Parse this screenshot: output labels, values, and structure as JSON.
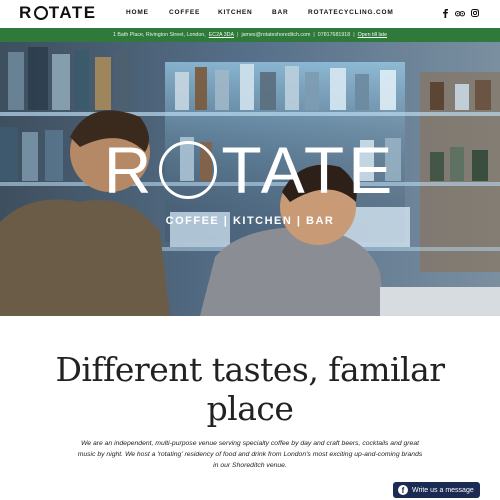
{
  "header": {
    "logo_prefix": "R",
    "logo_suffix": "TATE",
    "nav": [
      "HOME",
      "COFFEE",
      "KITCHEN",
      "BAR",
      "ROTATECYCLING.COM"
    ],
    "social_icons": [
      "facebook-icon",
      "tripadvisor-icon",
      "instagram-icon"
    ]
  },
  "infobar": {
    "address": "1 Bath Place, Rivington Street, London,",
    "postcode": "EC2A 3DA",
    "email": "james@rotateshoreditch.com",
    "phone": "07817681918",
    "hours": "Open till late",
    "separator": "|"
  },
  "hero": {
    "title_prefix": "R",
    "title_suffix": "TATE",
    "subtitle": "COFFEE | KITCHEN | BAR"
  },
  "main": {
    "headline": "Different tastes, familar place",
    "intro": "We are an independent, multi-purpose venue serving specialty coffee by day and craft beers, cocktails and great music by night. We host a 'rotating' residency of food and drink from London's most exciting up-and-coming brands in our Shoreditch venue."
  },
  "messenger": {
    "label": "Write us a message",
    "icon": "facebook-messenger-icon"
  },
  "colors": {
    "infobar_bg": "#2f7a3a",
    "messenger_bg": "#1c2b54"
  }
}
